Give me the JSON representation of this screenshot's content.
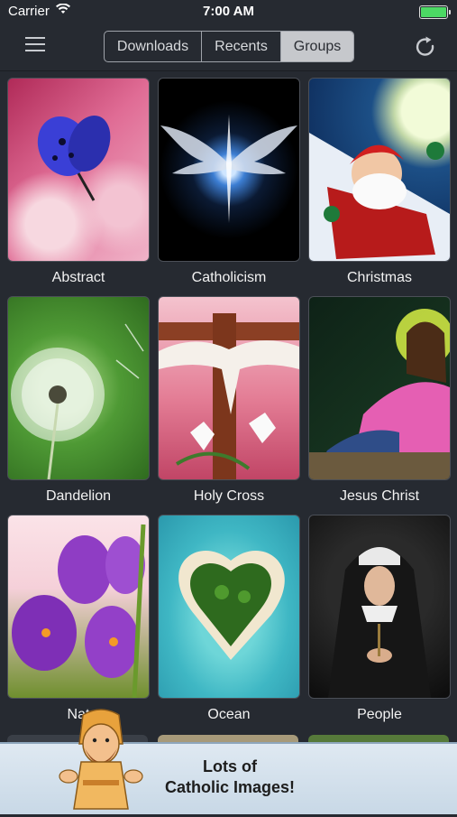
{
  "status_bar": {
    "carrier": "Carrier",
    "time": "7:00 AM"
  },
  "nav": {
    "segments": [
      "Downloads",
      "Recents",
      "Groups"
    ],
    "active_segment": "Groups"
  },
  "groups": [
    {
      "label": "Abstract"
    },
    {
      "label": "Catholicism"
    },
    {
      "label": "Christmas"
    },
    {
      "label": "Dandelion"
    },
    {
      "label": "Holy Cross"
    },
    {
      "label": "Jesus Christ"
    },
    {
      "label": "Nat"
    },
    {
      "label": "Ocean"
    },
    {
      "label": "People"
    }
  ],
  "banner": {
    "line1": "Lots of",
    "line2": "Catholic Images!"
  },
  "colors": {
    "background": "#262a31",
    "battery": "#4cd964",
    "segment_active": "#c6c8cc"
  }
}
